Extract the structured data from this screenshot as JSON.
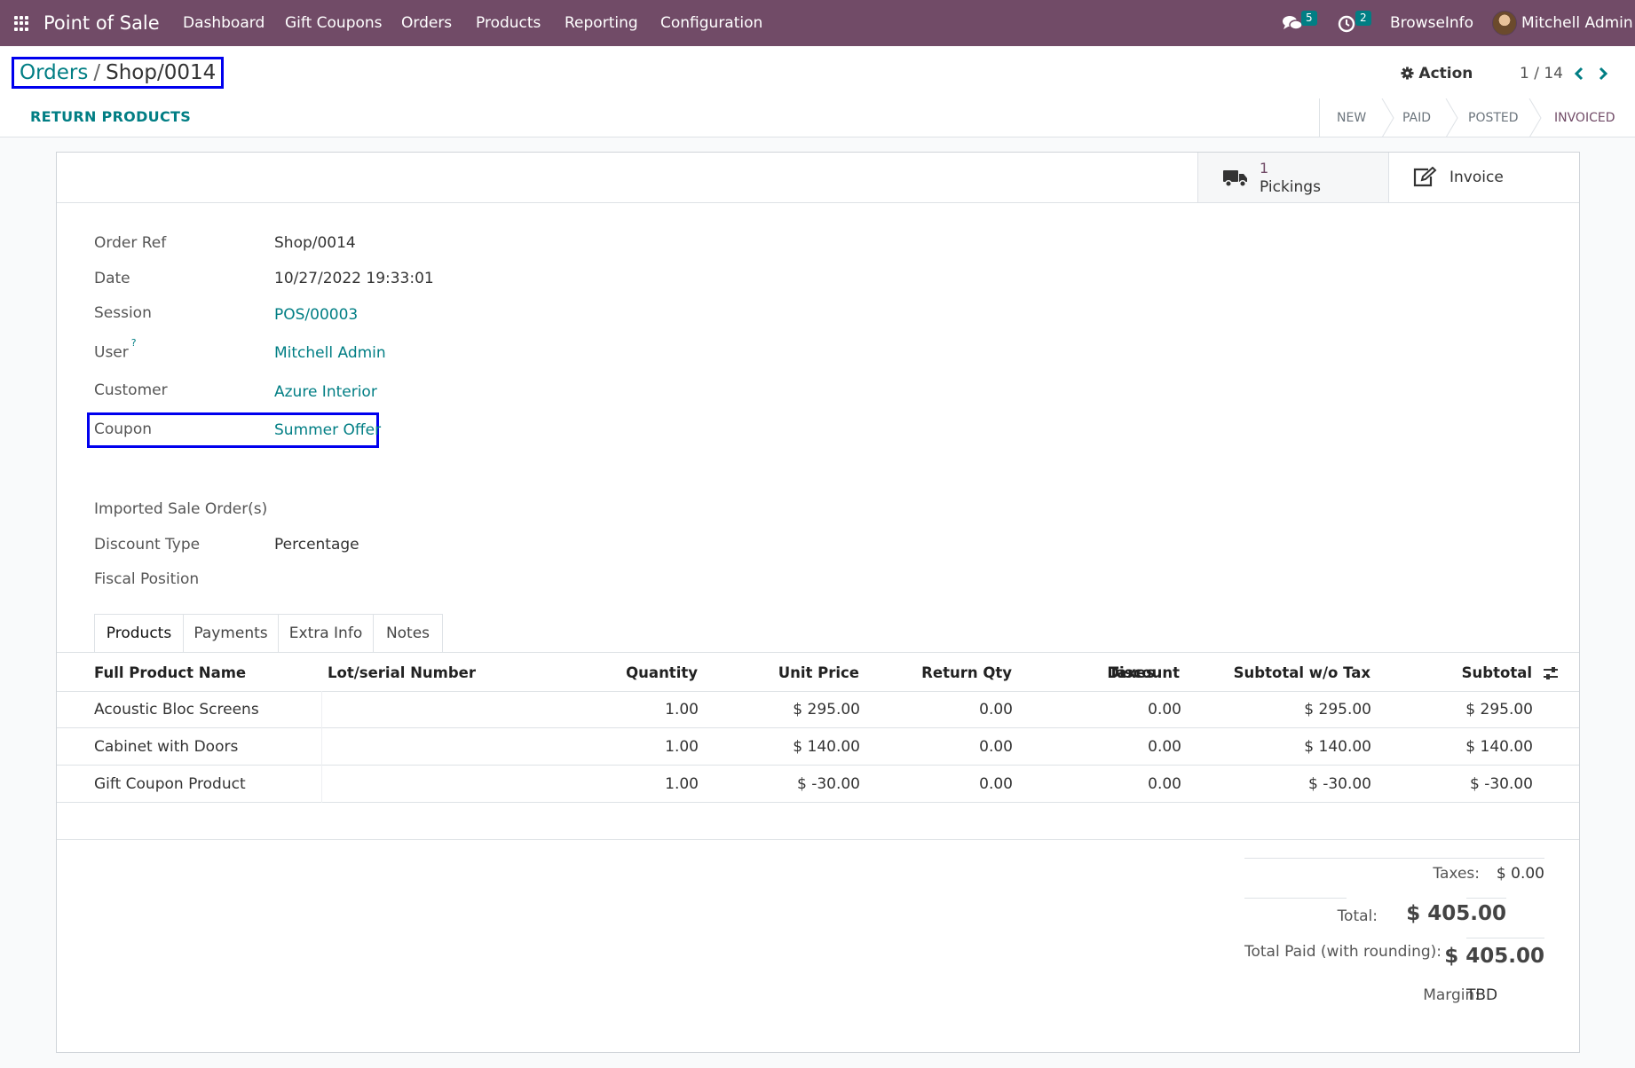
{
  "navbar": {
    "app_name": "Point of Sale",
    "menu": [
      "Dashboard",
      "Gift Coupons",
      "Orders",
      "Products",
      "Reporting",
      "Configuration"
    ],
    "messages_count": "5",
    "activities_count": "2",
    "company": "BrowseInfo",
    "user": "Mitchell Admin",
    "color": "#714b67"
  },
  "breadcrumb": {
    "parent": "Orders",
    "separator": "/",
    "current": "Shop/0014"
  },
  "control": {
    "action_label": "Action",
    "pager": "1 / 14",
    "return_button": "RETURN PRODUCTS"
  },
  "statusbar": [
    "NEW",
    "PAID",
    "POSTED",
    "INVOICED"
  ],
  "smart_buttons": {
    "pickings_count": "1",
    "pickings_label": "Pickings",
    "invoice_label": "Invoice"
  },
  "fields": {
    "order_ref_label": "Order Ref",
    "order_ref": "Shop/0014",
    "date_label": "Date",
    "date": "10/27/2022 19:33:01",
    "session_label": "Session",
    "session": "POS/00003",
    "user_label": "User",
    "user_help": "?",
    "user": "Mitchell Admin",
    "customer_label": "Customer",
    "customer": "Azure Interior",
    "coupon_label": "Coupon",
    "coupon": "Summer Offer",
    "imported_label": "Imported Sale Order(s)",
    "discount_type_label": "Discount Type",
    "discount_type": "Percentage",
    "fiscal_position_label": "Fiscal Position"
  },
  "tabs": [
    "Products",
    "Payments",
    "Extra Info",
    "Notes"
  ],
  "table": {
    "headers": [
      "Full Product Name",
      "Lot/serial Number",
      "Quantity",
      "Unit Price",
      "Return Qty",
      "Discount",
      "Taxes",
      "Subtotal w/o Tax",
      "Subtotal"
    ],
    "rows": [
      [
        "Acoustic Bloc Screens",
        "",
        "1.00",
        "$ 295.00",
        "0.00",
        "0.00",
        "",
        "$ 295.00",
        "$ 295.00"
      ],
      [
        "Cabinet with Doors",
        "",
        "1.00",
        "$ 140.00",
        "0.00",
        "0.00",
        "",
        "$ 140.00",
        "$ 140.00"
      ],
      [
        "Gift Coupon Product",
        "",
        "1.00",
        "$ -30.00",
        "0.00",
        "0.00",
        "",
        "$ -30.00",
        "$ -30.00"
      ]
    ]
  },
  "totals": {
    "taxes_label": "Taxes:",
    "taxes": "$ 0.00",
    "total_label": "Total:",
    "total": "$ 405.00",
    "paid_label": "Total Paid (with rounding):",
    "paid": "$ 405.00",
    "margin_label": "Margin:",
    "margin": "TBD"
  }
}
